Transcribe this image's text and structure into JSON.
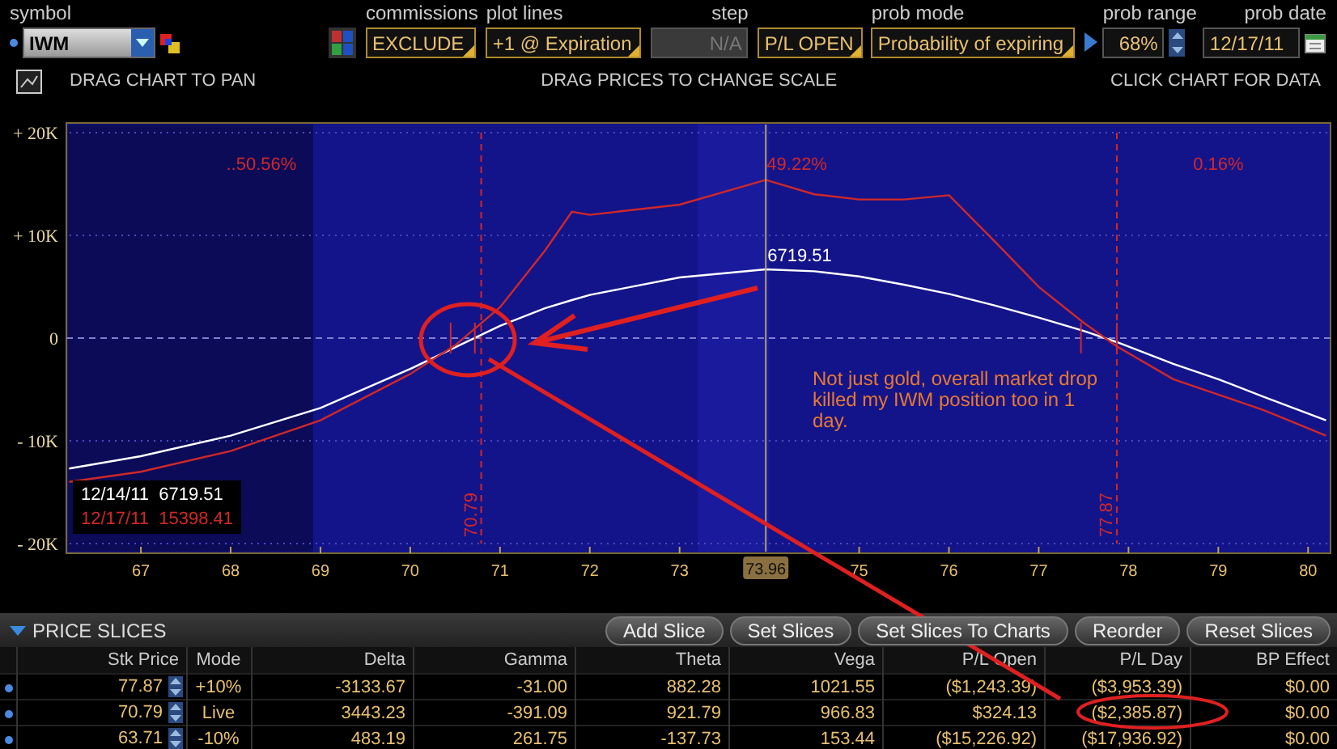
{
  "toolbar": {
    "symbol": {
      "label": "symbol",
      "value": "IWM"
    },
    "commissions": {
      "label": "commissions",
      "value": "EXCLUDE"
    },
    "plot_lines": {
      "label": "plot lines",
      "value": "+1 @ Expiration"
    },
    "step": {
      "label": "step",
      "value": "N/A",
      "disabled": true
    },
    "pl_mode": {
      "value": "P/L OPEN"
    },
    "prob_mode": {
      "label": "prob mode",
      "value": "Probability of expiring"
    },
    "prob_range": {
      "label": "prob range",
      "value": "68%"
    },
    "prob_date": {
      "label": "prob date",
      "value": "12/17/11"
    }
  },
  "hints": [
    "DRAG CHART TO PAN",
    "DRAG PRICES TO CHANGE SCALE",
    "CLICK CHART FOR DATA"
  ],
  "chart": {
    "chart_data": {
      "type": "line",
      "xlim": [
        66.17,
        80.25
      ],
      "ylim": [
        -20000,
        20000
      ],
      "xticks": [
        67,
        68,
        69,
        70,
        71,
        72,
        73,
        75,
        76,
        77,
        78,
        79,
        80
      ],
      "yticks": [
        {
          "value": 20000,
          "label": "+ 20K"
        },
        {
          "value": 10000,
          "label": "+ 10K"
        },
        {
          "value": 0,
          "label": "0"
        },
        {
          "value": -10000,
          "label": "- 10K"
        },
        {
          "value": -20000,
          "label": "- 20K"
        }
      ],
      "x": [
        66.2,
        67,
        68,
        69,
        70,
        70.5,
        71,
        71.5,
        71.8,
        72,
        73,
        73.96,
        74.5,
        75,
        75.5,
        76,
        76.5,
        77,
        77.5,
        77.87,
        78.5,
        79,
        79.5,
        80.2
      ],
      "series": [
        {
          "name": "12/14/11",
          "color": "#ffffff",
          "values": [
            -12700,
            -11500,
            -9500,
            -6800,
            -3000,
            -900,
            1200,
            2900,
            3700,
            4200,
            5900,
            6700,
            6500,
            6000,
            5200,
            4300,
            3200,
            2000,
            700,
            -400,
            -2500,
            -4000,
            -5700,
            -8000
          ]
        },
        {
          "name": "12/17/11",
          "color": "#d02828",
          "values": [
            -14000,
            -13000,
            -11000,
            -8000,
            -3500,
            -700,
            3000,
            8500,
            12300,
            12000,
            13000,
            15400,
            14000,
            13500,
            13500,
            13900,
            9500,
            5000,
            1500,
            -800,
            -4000,
            -5500,
            -7000,
            -9500
          ]
        }
      ],
      "grid": true,
      "ref_lines": [
        {
          "axis": "y",
          "value": 0,
          "color": "#8080d0"
        },
        {
          "axis": "x",
          "value": 70.79,
          "label": "70.79",
          "color": "#d02828"
        },
        {
          "axis": "x",
          "value": 77.87,
          "label": "77.87",
          "color": "#d02828"
        }
      ],
      "annotations": [
        {
          "x": 73.96,
          "text": "73.96"
        },
        {
          "x": 73.96,
          "y": 6700,
          "text": "6719.51"
        }
      ]
    },
    "zone_labels": [
      "..50.56%",
      "49.22%",
      "0.16%"
    ],
    "legend": [
      {
        "value": "6719.51"
      },
      {
        "value": "15398.41"
      }
    ],
    "note": "Not just gold, overall market drop killed my IWM position too in 1 day."
  },
  "price_slices": {
    "title": "PRICE SLICES",
    "expanded": true,
    "buttons": [
      "Add Slice",
      "Set Slices",
      "Set Slices To Charts",
      "Reorder",
      "Reset Slices"
    ],
    "columns": [
      "Stk Price",
      "Mode",
      "Delta",
      "Gamma",
      "Theta",
      "Vega",
      "P/L Open",
      "P/L Day",
      "BP Effect"
    ],
    "rows": [
      {
        "cells": [
          "77.87",
          "+10%",
          "-3133.67",
          "-31.00",
          "882.28",
          "1021.55",
          "($1,243.39)",
          "($3,953.39)",
          "$0.00"
        ]
      },
      {
        "cells": [
          "70.79",
          "Live",
          "3443.23",
          "-391.09",
          "921.79",
          "966.83",
          "$324.13",
          "($2,385.87)",
          "$0.00"
        ]
      },
      {
        "cells": [
          "63.71",
          "-10%",
          "483.19",
          "261.75",
          "-137.73",
          "153.44",
          "($15,226.92)",
          "($17,936.92)",
          "$0.00"
        ]
      }
    ]
  }
}
